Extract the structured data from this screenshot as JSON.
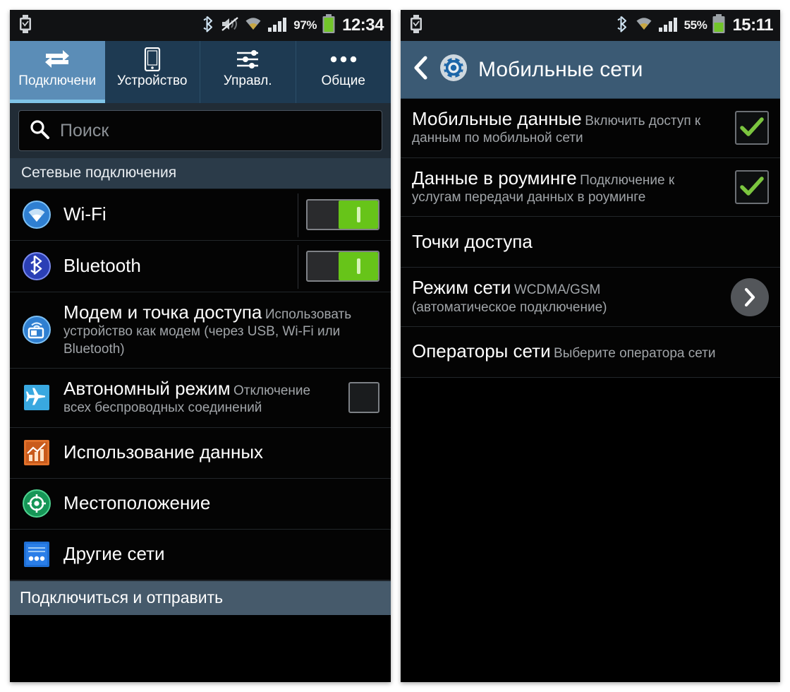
{
  "left_phone": {
    "status_bar": {
      "icons_left": [
        "smartwatch-icon"
      ],
      "icons_right": [
        "bluetooth-icon",
        "mute-icon",
        "wifi-icon",
        "signal-icon"
      ],
      "battery_percent": "97%",
      "time": "12:34"
    },
    "tabs": [
      {
        "label": "Подключени",
        "icon": "connections-arrows-icon",
        "active": true
      },
      {
        "label": "Устройство",
        "icon": "phone-icon",
        "active": false
      },
      {
        "label": "Управл.",
        "icon": "sliders-icon",
        "active": false
      },
      {
        "label": "Общие",
        "icon": "more-dots-icon",
        "active": false
      }
    ],
    "search": {
      "placeholder": "Поиск",
      "value": "",
      "icon": "search-icon"
    },
    "section_header": "Сетевые подключения",
    "items": [
      {
        "title": "Wi-Fi",
        "subtitle": "",
        "icon": "wifi-circle-icon",
        "control": "toggle",
        "control_state": "on"
      },
      {
        "title": "Bluetooth",
        "subtitle": "",
        "icon": "bluetooth-circle-icon",
        "control": "toggle",
        "control_state": "on"
      },
      {
        "title": "Модем и точка доступа",
        "subtitle": "Использовать устройство как модем (через USB, Wi-Fi или Bluetooth)",
        "icon": "tethering-icon",
        "control": "none",
        "control_state": ""
      },
      {
        "title": "Автономный режим",
        "subtitle": "Отключение всех беспроводных соединений",
        "icon": "airplane-icon",
        "control": "checkbox",
        "control_state": "off"
      },
      {
        "title": "Использование данных",
        "subtitle": "",
        "icon": "data-usage-chart-icon",
        "control": "none",
        "control_state": ""
      },
      {
        "title": "Местоположение",
        "subtitle": "",
        "icon": "location-target-icon",
        "control": "none",
        "control_state": ""
      },
      {
        "title": "Другие сети",
        "subtitle": "",
        "icon": "more-networks-icon",
        "control": "none",
        "control_state": ""
      }
    ],
    "footer": "Подключиться и отправить"
  },
  "right_phone": {
    "status_bar": {
      "icons_left": [
        "smartwatch-icon"
      ],
      "icons_right": [
        "bluetooth-icon",
        "wifi-icon",
        "signal-icon"
      ],
      "battery_percent": "55%",
      "time": "15:11"
    },
    "header": {
      "back_icon": "back-chevron-icon",
      "app_icon": "settings-gear-icon",
      "title": "Мобильные сети"
    },
    "items": [
      {
        "title": "Мобильные данные",
        "subtitle": "Включить доступ к данным по мобильной сети",
        "control": "checkbox",
        "control_state": "on"
      },
      {
        "title": "Данные в роуминге",
        "subtitle": "Подключение к услугам передачи данных в роуминге",
        "control": "checkbox",
        "control_state": "on"
      },
      {
        "title": "Точки доступа",
        "subtitle": "",
        "control": "none",
        "control_state": ""
      },
      {
        "title": "Режим сети",
        "subtitle": "WCDMA/GSM\n(автоматическое подключение)",
        "control": "arrow",
        "control_state": ""
      },
      {
        "title": "Операторы сети",
        "subtitle": "Выберите оператора сети",
        "control": "none",
        "control_state": ""
      }
    ]
  },
  "colors": {
    "accent_blue": "#5b8db7",
    "tab_bar": "#1e3a52",
    "header_blue": "#3b5a74",
    "toggle_green": "#67c419",
    "check_green": "#7bc53f",
    "section_header": "#2b3b49",
    "footer_strip": "#465a6b"
  }
}
